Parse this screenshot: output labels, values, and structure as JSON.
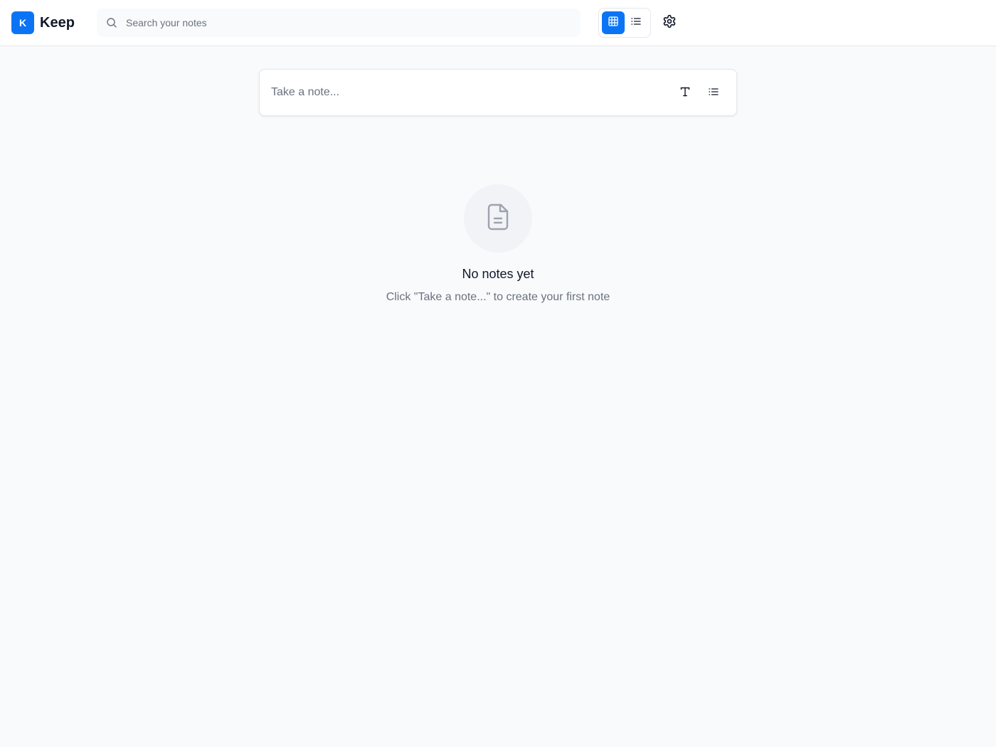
{
  "app": {
    "logo_letter": "K",
    "name": "Keep"
  },
  "search": {
    "placeholder": "Search your notes",
    "value": ""
  },
  "view_toggle": {
    "options": [
      "grid",
      "list"
    ],
    "selected": "grid"
  },
  "composer": {
    "placeholder": "Take a note..."
  },
  "empty_state": {
    "title": "No notes yet",
    "subtitle": "Click \"Take a note...\" to create your first note"
  },
  "icons": {
    "search": "search-icon",
    "grid": "grid-icon",
    "list": "list-icon",
    "settings": "gear-icon",
    "text": "text-format-icon",
    "checklist": "checklist-icon",
    "empty": "document-icon"
  },
  "colors": {
    "accent": "#0b74f5",
    "background": "#f8fafc"
  }
}
